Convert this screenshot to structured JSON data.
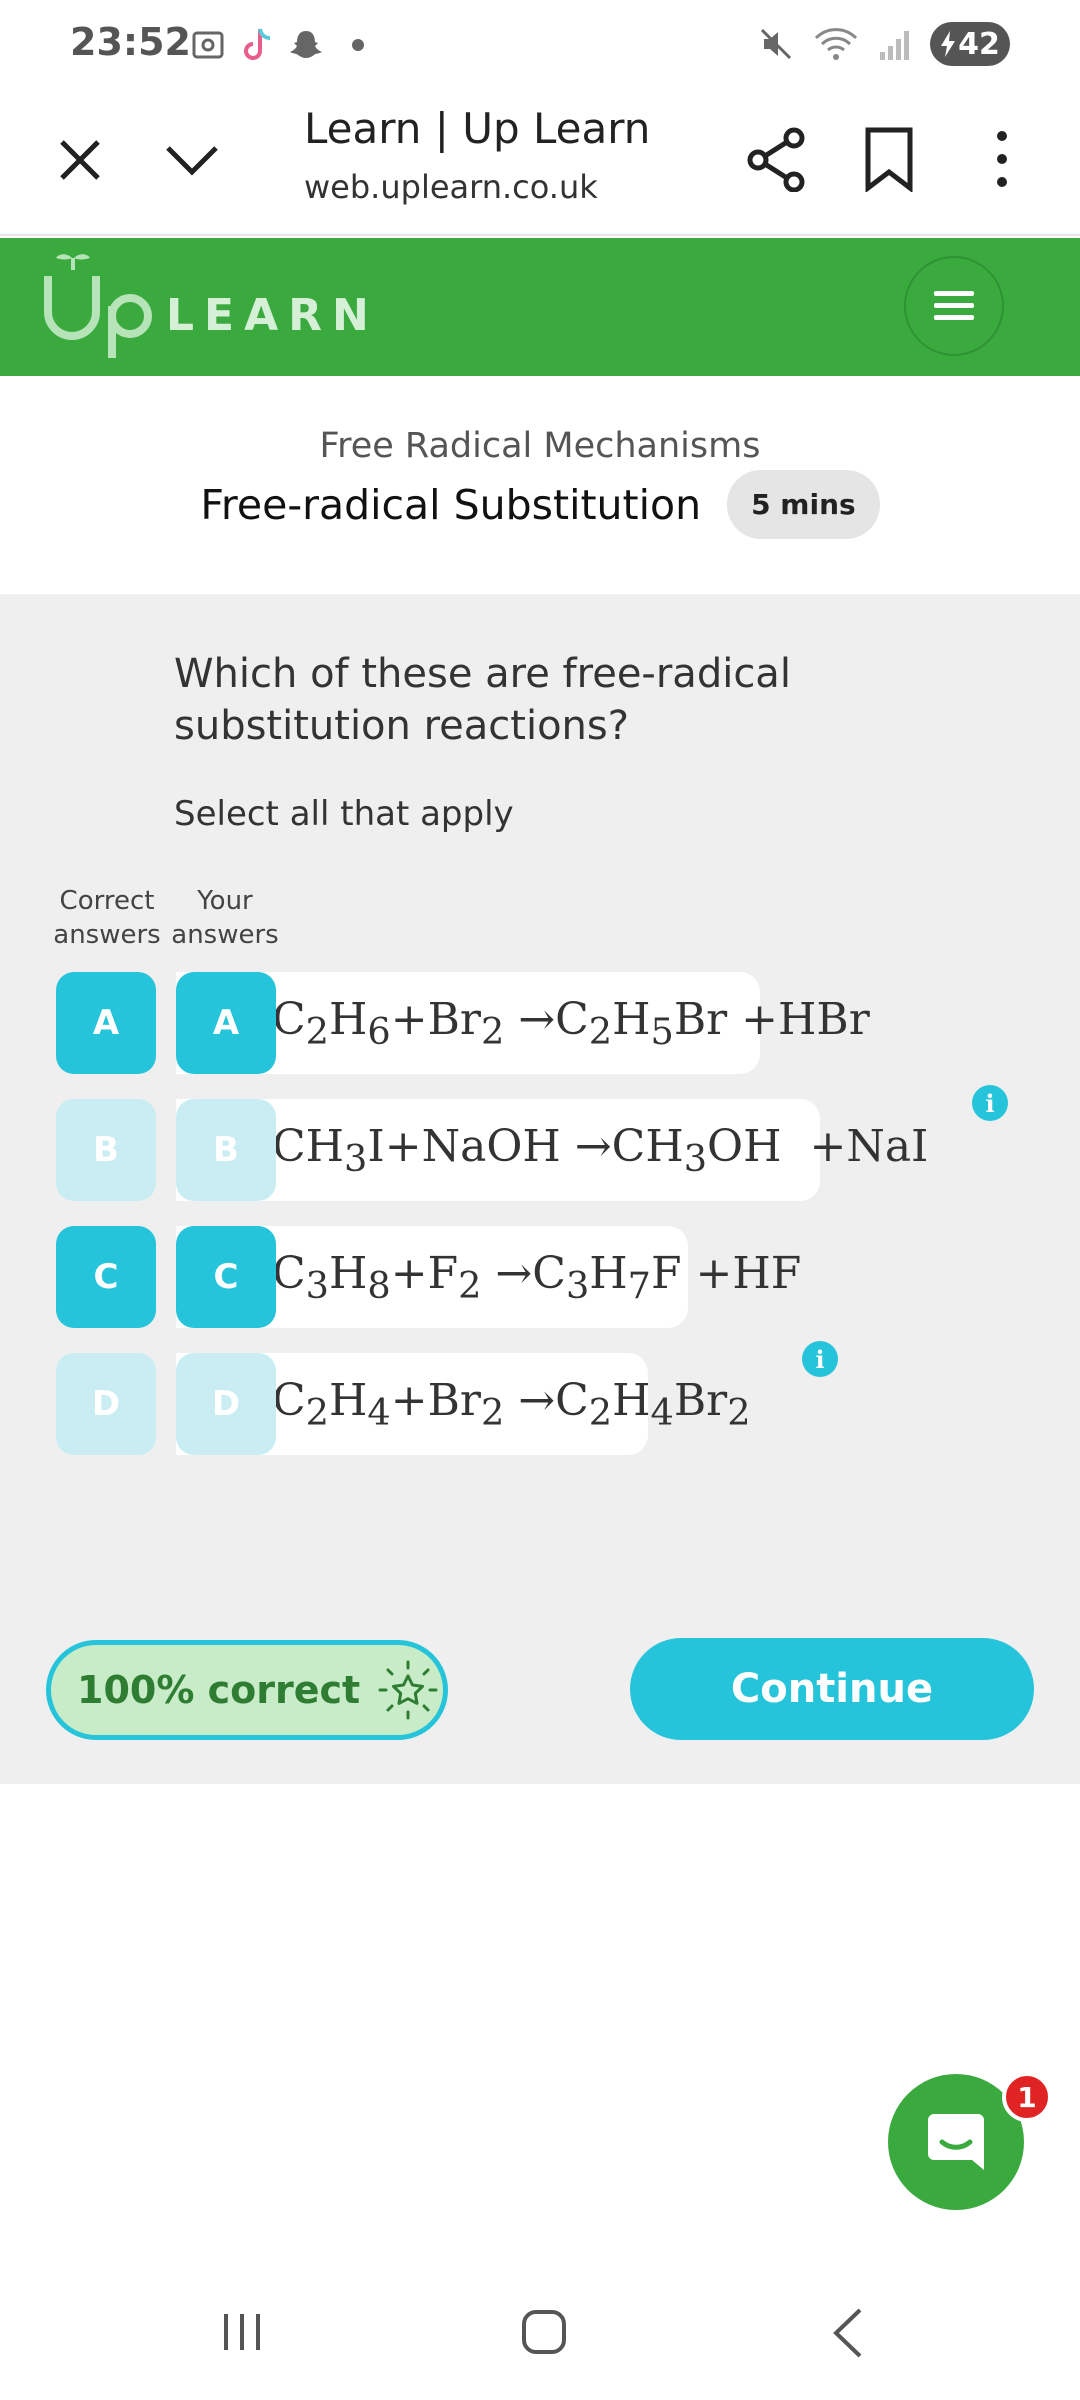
{
  "status_bar": {
    "time": "23:52",
    "battery": "42"
  },
  "browser": {
    "page_title": "Learn | Up Learn",
    "url": "web.uplearn.co.uk"
  },
  "site_header": {
    "brand_word": "LEARN",
    "brand_color": "#3aaa3f"
  },
  "lesson": {
    "section": "Free Radical Mechanisms",
    "title": "Free-radical Substitution",
    "duration": "5 mins"
  },
  "quiz": {
    "question": "Which of these are free-radical substitution reactions?",
    "instruction": "Select all that apply",
    "correct_col_label": "Correct answers",
    "your_col_label": "Your answers",
    "options": [
      {
        "letter": "A",
        "correct": true,
        "selected": true,
        "has_info": false,
        "formula_html": "C<sub>2</sub>H<sub>6</sub>+Br<sub>2</sub> &rarr;C<sub>2</sub>H<sub>5</sub>Br +HBr"
      },
      {
        "letter": "B",
        "correct": false,
        "selected": false,
        "has_info": true,
        "formula_html": "CH<sub>3</sub>I+NaOH &rarr;CH<sub>3</sub>OH &nbsp;+NaI"
      },
      {
        "letter": "C",
        "correct": true,
        "selected": true,
        "has_info": false,
        "formula_html": "C<sub>3</sub>H<sub>8</sub>+F<sub>2</sub> &rarr;C<sub>3</sub>H<sub>7</sub>F +HF"
      },
      {
        "letter": "D",
        "correct": false,
        "selected": false,
        "has_info": true,
        "formula_html": "C<sub>2</sub>H<sub>4</sub>+Br<sub>2</sub> &rarr;C<sub>2</sub>H<sub>4</sub>Br<sub>2</sub>"
      }
    ],
    "score_label": "100% correct",
    "continue_label": "Continue",
    "accent_color": "#26c4da"
  },
  "chat": {
    "badge_count": "1"
  }
}
